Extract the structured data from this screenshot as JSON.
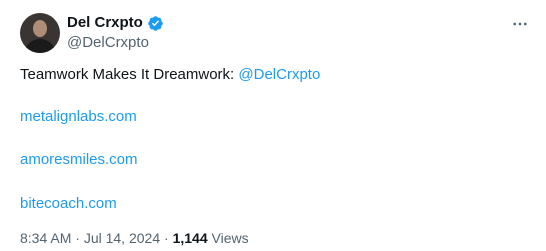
{
  "author": {
    "display_name": "Del Crxpto",
    "handle": "@DelCrxpto",
    "verified": true,
    "verified_badge_color": "#1d9bf0"
  },
  "tweet": {
    "text_prefix": "Teamwork Makes It Dreamwork: ",
    "mention": "@DelCrxpto",
    "links": [
      "metalignlabs.com",
      "amoresmiles.com",
      "bitecoach.com"
    ]
  },
  "meta": {
    "time": "8:34 AM",
    "separator1": " · ",
    "date": "Jul 14, 2024",
    "separator2": " · ",
    "views_count": "1,144",
    "views_label": " Views"
  },
  "icons": {
    "more": "more-horizontal-icon",
    "verified": "verified-badge-icon"
  },
  "colors": {
    "link": "#1d9bf0",
    "secondary_text": "#536471",
    "primary_text": "#0f1419"
  }
}
